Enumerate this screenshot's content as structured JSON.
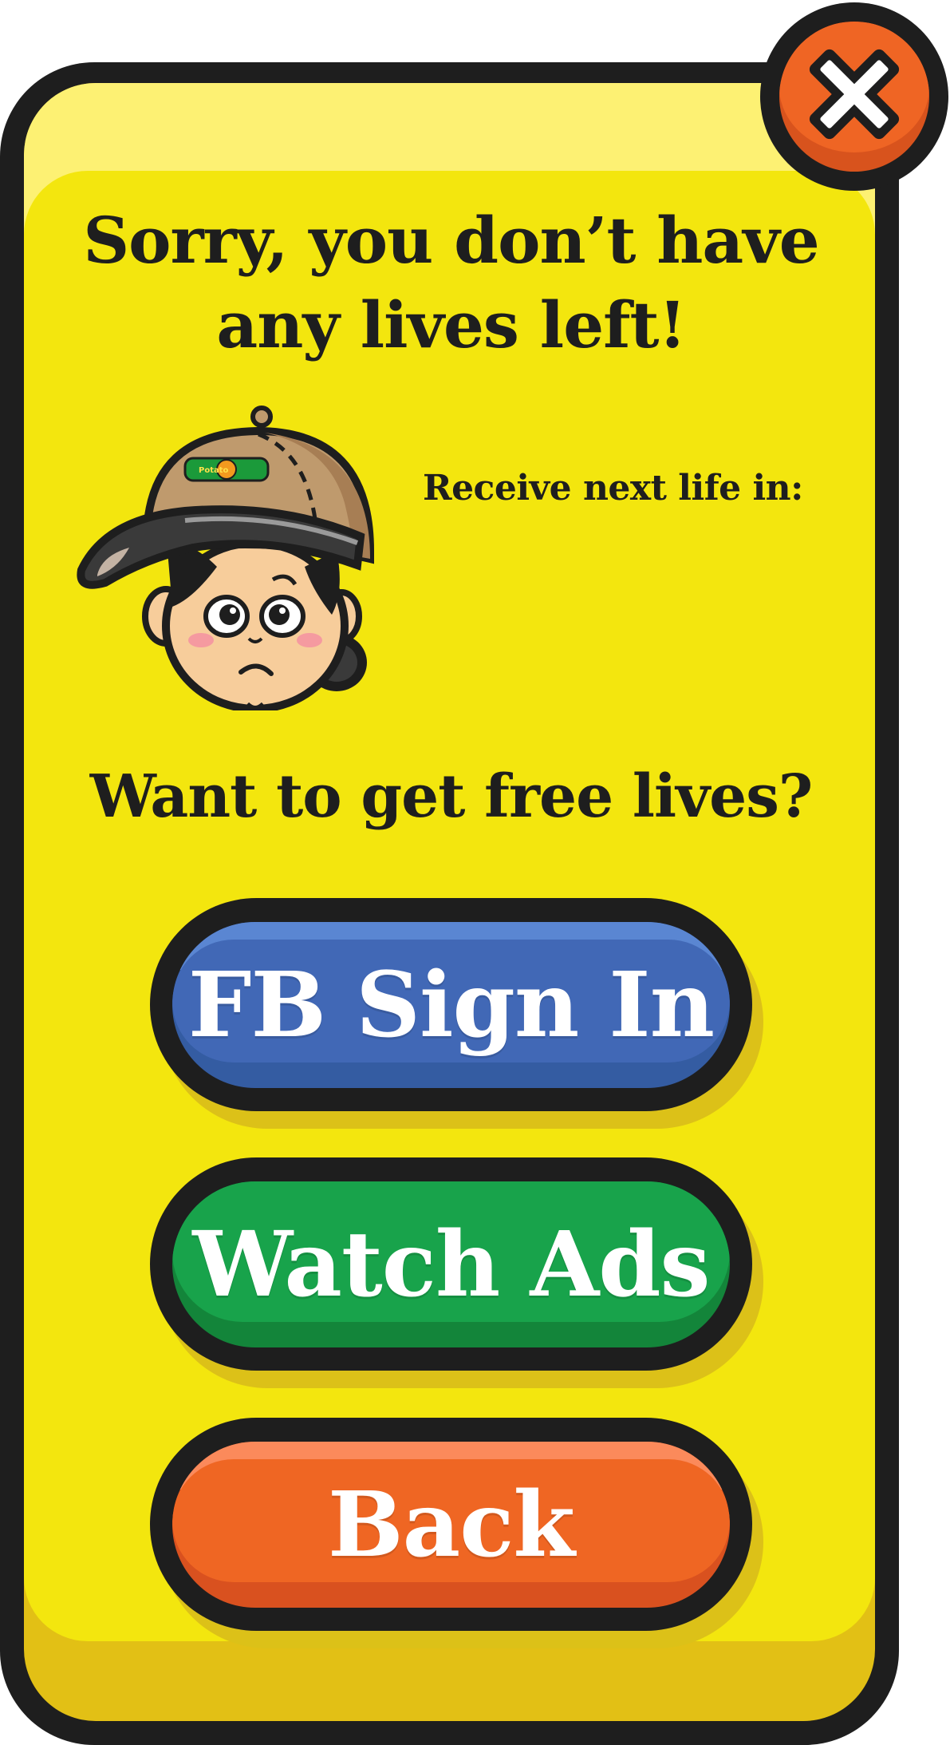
{
  "dialog": {
    "title": "Sorry, you don’t have any lives left!",
    "timer_label": "Receive next life in:",
    "timer_value": "",
    "question": "Want to get free lives?"
  },
  "mascot": {
    "cap_logo_text": "Potato Corner",
    "icon": "sad-mascot-icon"
  },
  "buttons": {
    "fb_sign_in": "FB Sign In",
    "watch_ads": "Watch Ads",
    "back": "Back",
    "close_icon": "close-icon"
  },
  "colors": {
    "panel_face": "#f3e60e",
    "panel_top": "#fdf173",
    "panel_bottom": "#e2c015",
    "outline": "#1e1e1e",
    "fb_blue": "#4168b6",
    "ads_green": "#18a34b",
    "back_orange": "#ef6623",
    "close_orange": "#ef6524"
  }
}
